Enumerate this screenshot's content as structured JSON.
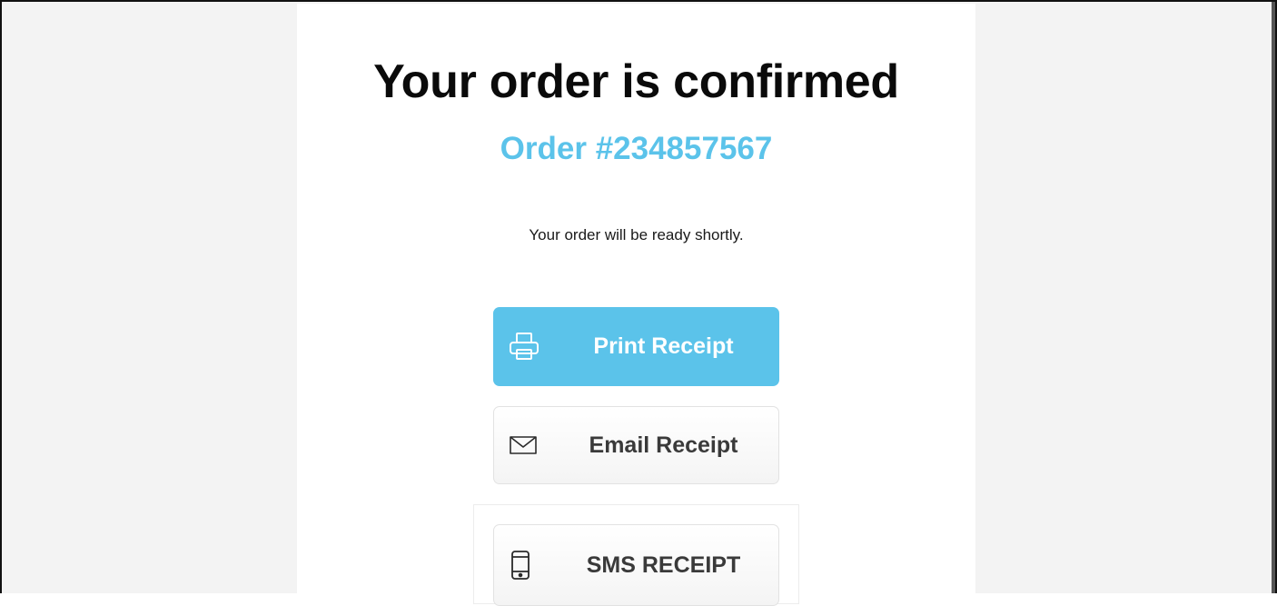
{
  "confirmation": {
    "title": "Your order is confirmed",
    "order_number": "Order #234857567",
    "message": "Your order will be ready shortly."
  },
  "actions": {
    "print": {
      "label": "Print Receipt",
      "icon": "printer-icon"
    },
    "email": {
      "label": "Email Receipt",
      "icon": "envelope-icon"
    },
    "sms": {
      "label": "SMS RECEIPT",
      "icon": "phone-icon"
    }
  },
  "colors": {
    "accent": "#5bc3ea",
    "background": "#f3f3f3",
    "panel": "#ffffff",
    "title_text": "#0a0a0a",
    "button_text_dark": "#3a3a3a"
  }
}
